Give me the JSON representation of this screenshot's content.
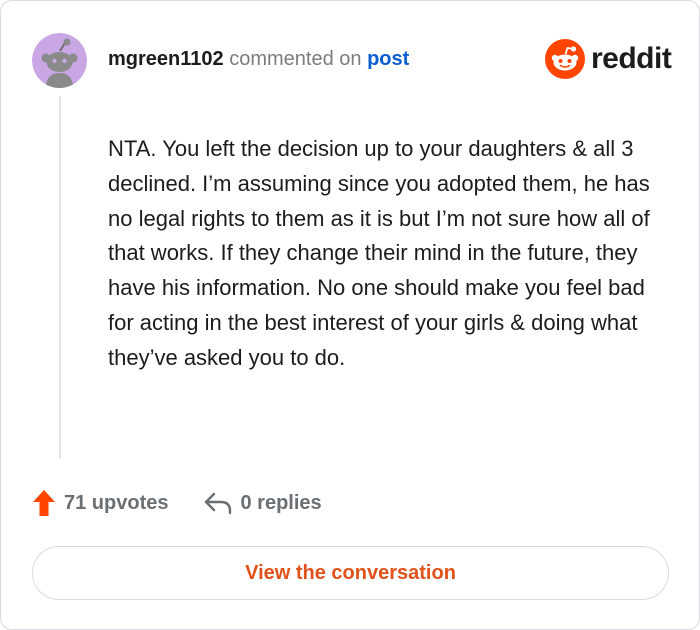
{
  "comment": {
    "username": "mgreen1102",
    "commented_on_text": "commented on",
    "post_link_label": "post",
    "body": "NTA. You left the decision up to your daughters & all 3 declined. I’m assuming since you adopted them, he has no legal rights to them as it is but I’m not sure how all of that works. If they change their mind in the future, they have his information. No one should make you feel bad for acting in the best interest of your girls & doing what they’ve asked you to do."
  },
  "brand": {
    "name": "reddit",
    "icon": "reddit-snoo-icon",
    "color": "#ff4500"
  },
  "avatar": {
    "icon": "snoo-avatar-icon",
    "color": "#c9a6e4"
  },
  "actions": {
    "upvotes_label": "71 upvotes",
    "upvote_icon": "upvote-arrow-icon",
    "upvote_color": "#ff4500",
    "replies_label": "0 replies",
    "reply_icon": "reply-arrow-icon"
  },
  "cta": {
    "label": "View the conversation",
    "color": "#e0521a"
  }
}
